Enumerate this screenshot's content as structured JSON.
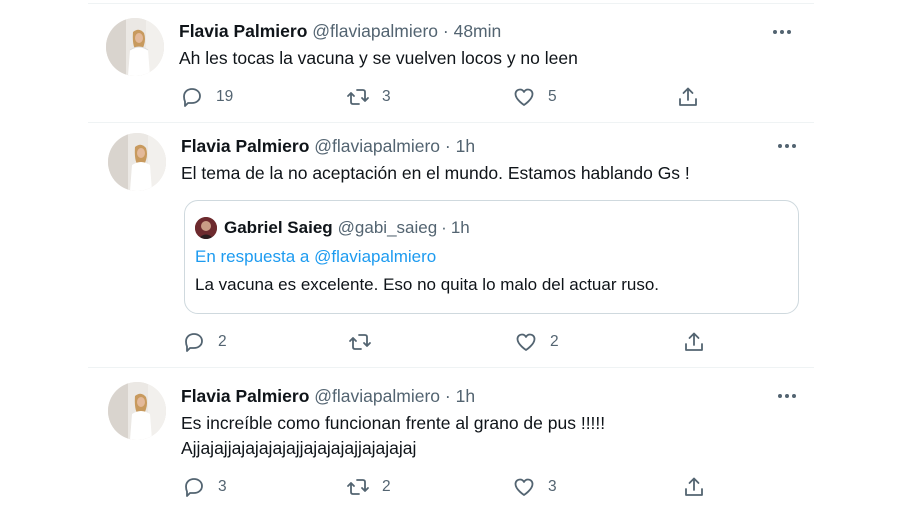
{
  "tweets": [
    {
      "name": "Flavia Palmiero",
      "handle": "@flaviapalmiero",
      "separator": "·",
      "time": "48min",
      "text": [
        "Ah les tocas la vacuna y se vuelven locos y no leen"
      ],
      "stats": {
        "replies": "19",
        "retweets": "3",
        "likes": "5"
      }
    },
    {
      "name": "Flavia Palmiero",
      "handle": "@flaviapalmiero",
      "separator": "·",
      "time": "1h",
      "text": [
        "El tema de la no aceptación en el mundo. Estamos hablando Gs !"
      ],
      "quote": {
        "name": "Gabriel Saieg",
        "handle": "@gabi_saieg",
        "separator": "·",
        "time": "1h",
        "reply_prefix": "En respuesta a",
        "reply_to": "@flaviapalmiero",
        "text": "La vacuna es excelente. Eso no quita lo malo del actuar ruso."
      },
      "stats": {
        "replies": "2",
        "retweets": "",
        "likes": "2"
      }
    },
    {
      "name": "Flavia Palmiero",
      "handle": "@flaviapalmiero",
      "separator": "·",
      "time": "1h",
      "text": [
        "Es increíble como funcionan frente al grano de pus !!!!!",
        "Ajjajajjajajajajajjajajajajjajajajaj"
      ],
      "stats": {
        "replies": "3",
        "retweets": "2",
        "likes": "3"
      }
    }
  ],
  "icons": {
    "reply": "reply-icon",
    "retweet": "retweet-icon",
    "like": "like-icon",
    "share": "share-icon",
    "more": "more-icon"
  },
  "colors": {
    "secondary_text": "#536471",
    "link": "#1d9bf0",
    "border": "#cfd9de"
  }
}
